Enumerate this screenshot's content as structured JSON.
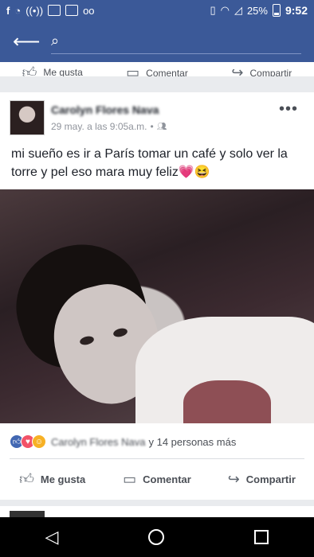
{
  "status_bar": {
    "battery_percent": "25%",
    "time": "9:52",
    "left_icons": [
      "facebook-notify-icon",
      "messenger-icon",
      "hotspot-icon",
      "image-icon",
      "gmail-icon",
      "voicemail-icon"
    ],
    "right_icons": [
      "vibrate-icon",
      "wifi-icon",
      "signal-icon",
      "battery-icon"
    ]
  },
  "app_bar": {
    "search_value": "",
    "back_icon": "arrow-left-icon",
    "search_icon": "search-icon"
  },
  "previous_post_actions": {
    "like": "Me gusta",
    "comment": "Comentar",
    "share": "Compartir"
  },
  "post": {
    "author": "Carolyn Flores Nava",
    "timestamp": "29 may. a las 9:05a.m.",
    "separator": "•",
    "privacy_icon": "friends-icon",
    "more_icon": "more-dots-icon",
    "text": "mi sueño es ir a París tomar un café  y solo ver la torre y pel eso mara muy feliz💗😆",
    "reactions": {
      "icons": [
        "like-reaction",
        "love-reaction",
        "haha-reaction"
      ],
      "names": "Carolyn Flores Nava",
      "others": "y 14 personas más"
    },
    "actions": {
      "like": "Me gusta",
      "comment": "Comentar",
      "share": "Compartir"
    }
  },
  "nav_bar": {
    "back": "nav-back-icon",
    "home": "nav-home-icon",
    "recent": "nav-recent-icon"
  },
  "colors": {
    "facebook_blue": "#3b5998",
    "background": "#e9ebee",
    "text_dark": "#1d2129",
    "text_muted": "#90949c"
  }
}
